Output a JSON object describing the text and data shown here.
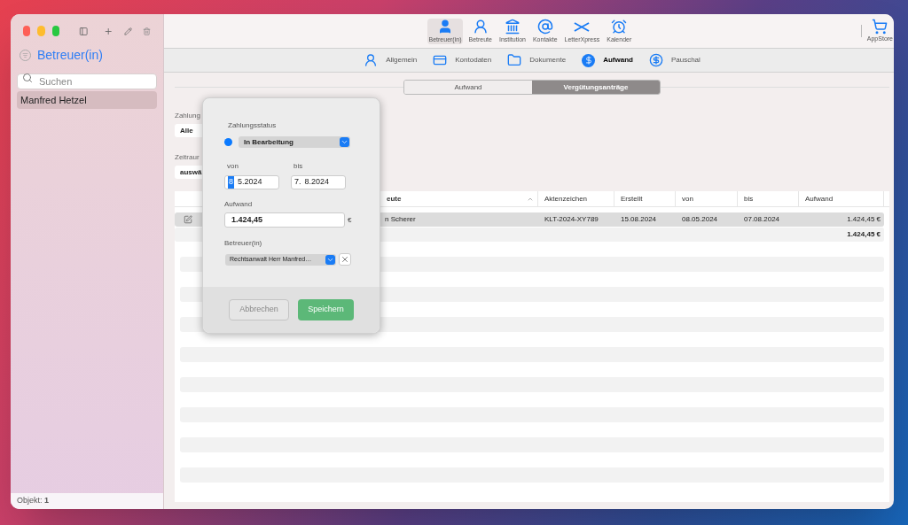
{
  "sidebar": {
    "title": "Betreuer(in)",
    "search": {
      "placeholder": "Suchen"
    },
    "items": [
      {
        "label": "Manfred Hetzel",
        "selected": true
      }
    ],
    "status": "Objekt: **1**"
  },
  "toolbar": {
    "items": [
      {
        "kind": "person-suit",
        "label": "Betreuer(in)",
        "selected": true
      },
      {
        "kind": "person",
        "label": "Betreute",
        "selected": false
      },
      {
        "kind": "bank",
        "label": "Institution",
        "selected": false
      },
      {
        "kind": "contacts",
        "label": "Kontakte",
        "selected": false
      },
      {
        "kind": "letter",
        "label": "LetterXpress",
        "selected": false
      },
      {
        "kind": "alarm",
        "label": "Kalender",
        "selected": false
      }
    ],
    "store": "AppStore"
  },
  "tabs": [
    {
      "kind": "person",
      "label": "Allgemein",
      "selected": false
    },
    {
      "kind": "card",
      "label": "Kontodaten",
      "selected": false
    },
    {
      "kind": "folder",
      "label": "Dokumente",
      "selected": false
    },
    {
      "kind": "money-filled",
      "label": "Aufwand",
      "selected": true
    },
    {
      "kind": "money",
      "label": "Pauschal",
      "selected": false
    }
  ],
  "segments": [
    {
      "label": "Aufwand",
      "selected": false
    },
    {
      "label": "Vergütungsanträge",
      "selected": true
    }
  ],
  "filters": [
    {
      "label": "Zahlung",
      "value": "Alle"
    },
    {
      "label": "Zeitraur",
      "value": "auswä"
    }
  ],
  "table": {
    "columns": [
      "eute",
      "Aktenzeichen",
      "Erstellt",
      "von",
      "bis",
      "Aufwand"
    ],
    "rows": [
      {
        "cells": [
          "n Scherer",
          "KLT-2024-XY789",
          "15.08.2024",
          "08.05.2024",
          "07.08.2024",
          "1.424,45 €"
        ],
        "selected": true
      }
    ],
    "total": "1.424,45 €"
  },
  "popover": {
    "status_label": "Zahlungsstatus",
    "status": {
      "value": "In Bearbeitung",
      "color": "#0a7aff"
    },
    "from": {
      "label": "von",
      "segments": [
        {
          "text": "8",
          "selected": true
        },
        {
          "text": "5.2024",
          "selected": false
        }
      ]
    },
    "to": {
      "label": "bis",
      "segments": [
        {
          "text": "7.",
          "selected": false
        },
        {
          "text": "8.2024",
          "selected": false
        }
      ]
    },
    "amount": {
      "label": "Aufwand",
      "value": "1.424,45",
      "currency": "€"
    },
    "guardian": {
      "label": "Betreuer(in)",
      "value": "Rechtsanwalt Herr Manfred…"
    },
    "cancel": "Abbrechen",
    "save": "Speichern"
  }
}
